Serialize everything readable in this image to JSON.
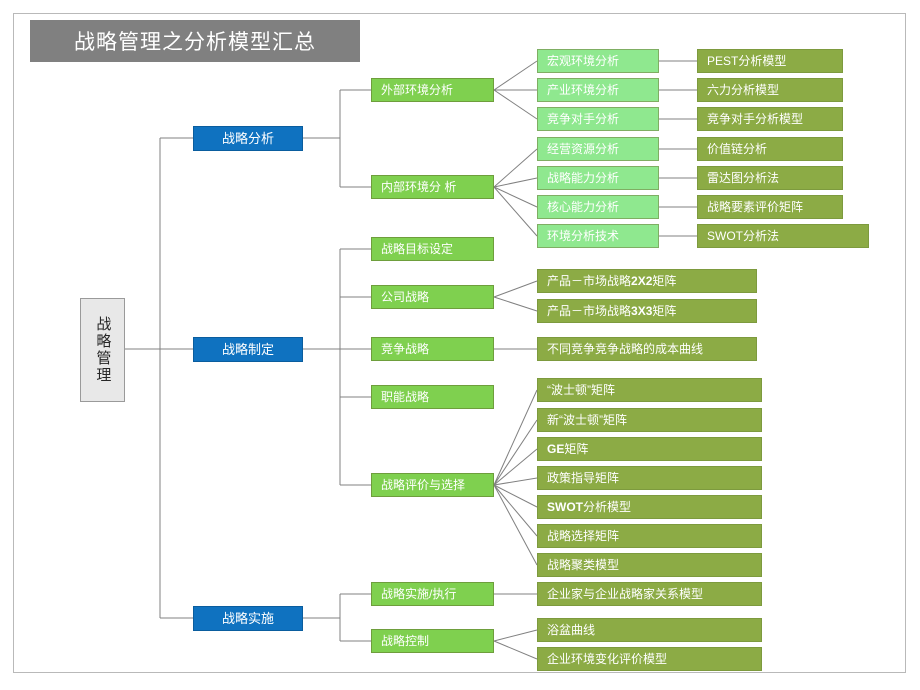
{
  "slide": {
    "title": "战略管理之分析模型汇总",
    "title_bg": "#808080",
    "accent_blue": "#0F72C0",
    "green_mid": "#7FD04F",
    "green_light": "#8FE88F",
    "green_olive": "#8CAB45"
  },
  "root": {
    "label": "战略管理"
  },
  "branches": [
    {
      "label": "战略分析"
    },
    {
      "label": "战略制定"
    },
    {
      "label": "战略实施"
    }
  ],
  "level2": [
    {
      "label": "外部环境分析"
    },
    {
      "label": "内部环境分 析"
    },
    {
      "label": "战略目标设定"
    },
    {
      "label": "公司战略"
    },
    {
      "label": "竞争战略"
    },
    {
      "label": "职能战略"
    },
    {
      "label": "战略评价与选择"
    },
    {
      "label": "战略实施/执行"
    },
    {
      "label": "战略控制"
    }
  ],
  "level3_light": [
    {
      "label": "宏观环境分析"
    },
    {
      "label": "产业环境分析"
    },
    {
      "label": "竞争对手分析"
    },
    {
      "label": "经营资源分析"
    },
    {
      "label": "战略能力分析"
    },
    {
      "label": "核心能力分析"
    },
    {
      "label": "环境分析技术"
    }
  ],
  "level3_olive_top": [
    {
      "label": "PEST分析模型"
    },
    {
      "label": "六力分析模型"
    },
    {
      "label": "竞争对手分析模型"
    },
    {
      "label": "价值链分析"
    },
    {
      "label": "雷达图分析法"
    },
    {
      "label": "战略要素评价矩阵"
    },
    {
      "label": "SWOT分析法"
    }
  ],
  "level3_company": [
    {
      "pre": "产品－市场战略",
      "bold": "2X2",
      "post": "矩阵"
    },
    {
      "pre": "产品－市场战略",
      "bold": "3X3",
      "post": "矩阵"
    }
  ],
  "level3_compete": [
    {
      "label": "不同竞争竞争战略的成本曲线"
    }
  ],
  "level3_eval": [
    {
      "pre": "“波士顿”矩阵",
      "bold": "",
      "post": ""
    },
    {
      "pre": "新“波士顿”矩阵",
      "bold": "",
      "post": ""
    },
    {
      "pre": "",
      "bold": "GE",
      "post": "矩阵"
    },
    {
      "pre": "政策指导矩阵",
      "bold": "",
      "post": ""
    },
    {
      "pre": "",
      "bold": "SWOT",
      "post": "分析模型"
    },
    {
      "pre": "战略选择矩阵",
      "bold": "",
      "post": ""
    },
    {
      "pre": "战略聚类模型",
      "bold": "",
      "post": ""
    }
  ],
  "level3_impl": [
    {
      "label": "企业家与企业战略家关系模型"
    }
  ],
  "level3_control": [
    {
      "label": "浴盆曲线"
    },
    {
      "label": "企业环境变化评价模型"
    }
  ]
}
